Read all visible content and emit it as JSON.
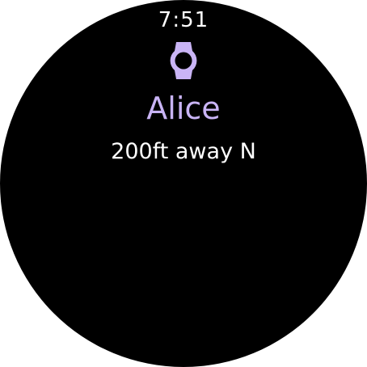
{
  "status_bar": {
    "time": "7:51"
  },
  "contact": {
    "icon": "watch-icon",
    "name": "Alice",
    "distance_text": "200ft away N"
  },
  "colors": {
    "background": "#000000",
    "accent": "#c9b4f5",
    "text": "#ffffff"
  }
}
